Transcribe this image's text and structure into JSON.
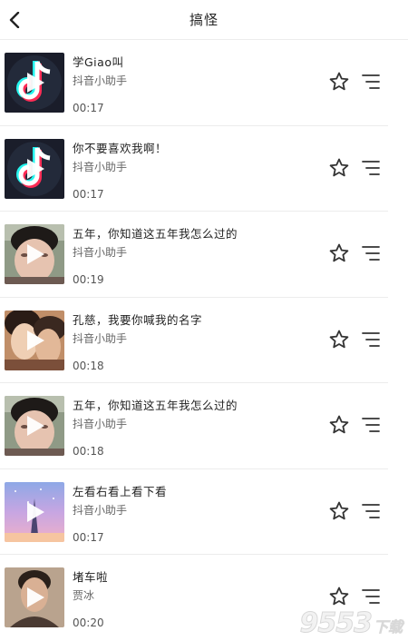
{
  "header": {
    "title": "搞怪"
  },
  "items": [
    {
      "title": "学Giao叫",
      "author": "抖音小助手",
      "duration": "00:17"
    },
    {
      "title": "你不要喜欢我啊！",
      "author": "抖音小助手",
      "duration": "00:17"
    },
    {
      "title": "五年，你知道这五年我怎么过的",
      "author": "抖音小助手",
      "duration": "00:19"
    },
    {
      "title": "孔慈，我要你喊我的名字",
      "author": "抖音小助手",
      "duration": "00:18"
    },
    {
      "title": "五年，你知道这五年我怎么过的",
      "author": "抖音小助手",
      "duration": "00:18"
    },
    {
      "title": "左看右看上看下看",
      "author": "抖音小助手",
      "duration": "00:17"
    },
    {
      "title": "堵车啦",
      "author": "贾冰",
      "duration": "00:20"
    }
  ],
  "watermark": {
    "number": "9553",
    "tail": "下载"
  },
  "colors": {
    "divider": "#ececec",
    "icon": "#333333",
    "text_primary": "#222222",
    "text_secondary": "#666666"
  }
}
